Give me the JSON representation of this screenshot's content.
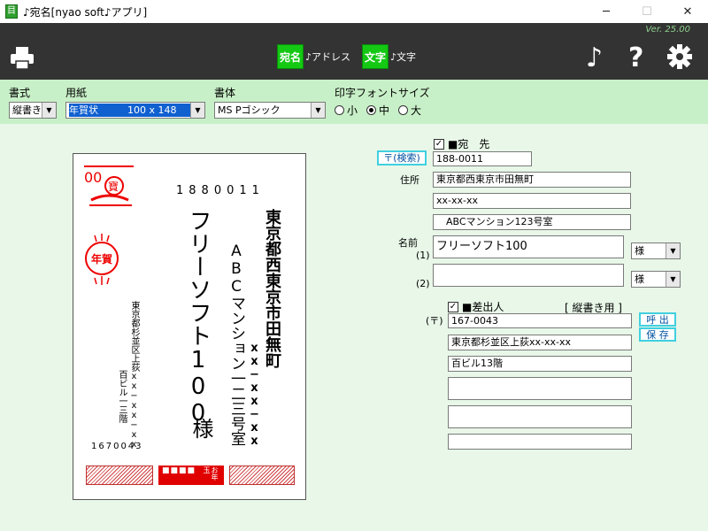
{
  "window": {
    "title": "♪宛名[nyao soft♪アプリ]",
    "icon_glyph": "目"
  },
  "toolbar": {
    "version": "Ver. 25.00",
    "mode_address_icon": "宛名",
    "mode_address_label": "♪アドレス",
    "mode_text_icon": "文字",
    "mode_text_label": "♪文字"
  },
  "options": {
    "style_label": "書式",
    "style_value": "縦書き",
    "paper_label": "用紙",
    "paper_value": "年賀状　　　100 x 148",
    "font_label": "書体",
    "font_value": "MS Pゴシック",
    "fontsize_label": "印字フォントサイズ",
    "fontsize_options": [
      "小",
      "中",
      "大"
    ],
    "fontsize_selected": "中"
  },
  "card": {
    "postal_code": "1880011",
    "recipient_address1": "東京都西東京市田無町",
    "recipient_address2": "xx−xx−xx",
    "recipient_address3": "ABCマンション一二三号室",
    "recipient_name": "フリーソフト100",
    "honorific": "様",
    "sender_address1": "東京都杉並区上荻xx−xx−xx",
    "sender_address2": "百ビル一三階",
    "sender_zip": "1670043",
    "stamp_text": "寶",
    "stamp_number": "00",
    "nenga_mark": "年賀",
    "otoshidama_mark": "お年玉"
  },
  "recipient": {
    "checkbox_label": "■宛　先",
    "search_button": "〒(検索)",
    "zip": "188-0011",
    "address_label": "住所",
    "address1": "東京都西東京市田無町",
    "address2": "xx-xx-xx",
    "address3": "　ABCマンション123号室",
    "name_label": "名前",
    "name1_index": "(1)",
    "name1": "フリーソフト100",
    "honorific1": "様",
    "name2_index": "(2)",
    "name2": "",
    "honorific2": "様"
  },
  "sender": {
    "checkbox_label": "■差出人",
    "mode_note": "[ 縦書き用 ]",
    "zip_label": "(〒)",
    "zip": "167-0043",
    "address1": "東京都杉並区上荻xx-xx-xx",
    "address2": "百ビル13階",
    "address3": "",
    "address4": "",
    "address5": "",
    "call_button": "呼 出",
    "save_button": "保 存"
  }
}
